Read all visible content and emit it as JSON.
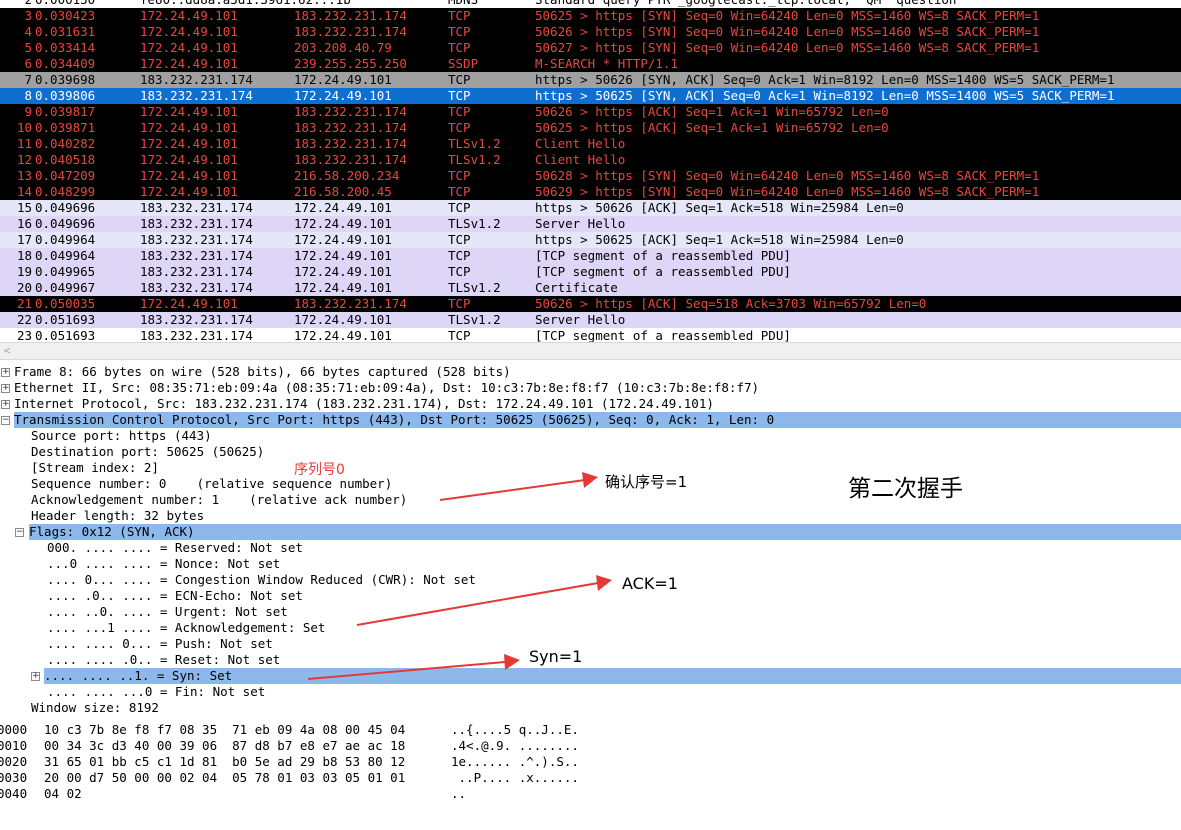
{
  "packet_list": {
    "partial_top_row": {
      "no": "2",
      "time": "0.000150",
      "src": "fe80::dd8a:a5d1:3961:62...1b",
      "dst": "",
      "proto": "MDNS",
      "info": "Standard query PTR _googlecast._tcp.local, \"QM\" question"
    },
    "rows": [
      {
        "no": "3",
        "time": "0.030423",
        "src": "172.24.49.101",
        "dst": "183.232.231.174",
        "proto": "TCP",
        "info": "50625 > https [SYN] Seq=0 Win=64240 Len=0 MSS=1460 WS=8 SACK_PERM=1",
        "style": "black"
      },
      {
        "no": "4",
        "time": "0.031631",
        "src": "172.24.49.101",
        "dst": "183.232.231.174",
        "proto": "TCP",
        "info": "50626 > https [SYN] Seq=0 Win=64240 Len=0 MSS=1460 WS=8 SACK_PERM=1",
        "style": "black"
      },
      {
        "no": "5",
        "time": "0.033414",
        "src": "172.24.49.101",
        "dst": "203.208.40.79",
        "proto": "TCP",
        "info": "50627 > https [SYN] Seq=0 Win=64240 Len=0 MSS=1460 WS=8 SACK_PERM=1",
        "style": "black"
      },
      {
        "no": "6",
        "time": "0.034409",
        "src": "172.24.49.101",
        "dst": "239.255.255.250",
        "proto": "SSDP",
        "info": "M-SEARCH * HTTP/1.1",
        "style": "black"
      },
      {
        "no": "7",
        "time": "0.039698",
        "src": "183.232.231.174",
        "dst": "172.24.49.101",
        "proto": "TCP",
        "info": "https > 50626 [SYN, ACK] Seq=0 Ack=1 Win=8192 Len=0 MSS=1400 WS=5 SACK_PERM=1",
        "style": "grey"
      },
      {
        "no": "8",
        "time": "0.039806",
        "src": "183.232.231.174",
        "dst": "172.24.49.101",
        "proto": "TCP",
        "info": "https > 50625 [SYN, ACK] Seq=0 Ack=1 Win=8192 Len=0 MSS=1400 WS=5 SACK_PERM=1",
        "style": "sel"
      },
      {
        "no": "9",
        "time": "0.039817",
        "src": "172.24.49.101",
        "dst": "183.232.231.174",
        "proto": "TCP",
        "info": "50626 > https [ACK] Seq=1 Ack=1 Win=65792 Len=0",
        "style": "black"
      },
      {
        "no": "10",
        "time": "0.039871",
        "src": "172.24.49.101",
        "dst": "183.232.231.174",
        "proto": "TCP",
        "info": "50625 > https [ACK] Seq=1 Ack=1 Win=65792 Len=0",
        "style": "black"
      },
      {
        "no": "11",
        "time": "0.040282",
        "src": "172.24.49.101",
        "dst": "183.232.231.174",
        "proto": "TLSv1.2",
        "info": "Client Hello",
        "style": "black"
      },
      {
        "no": "12",
        "time": "0.040518",
        "src": "172.24.49.101",
        "dst": "183.232.231.174",
        "proto": "TLSv1.2",
        "info": "Client Hello",
        "style": "black"
      },
      {
        "no": "13",
        "time": "0.047209",
        "src": "172.24.49.101",
        "dst": "216.58.200.234",
        "proto": "TCP",
        "info": "50628 > https [SYN] Seq=0 Win=64240 Len=0 MSS=1460 WS=8 SACK_PERM=1",
        "style": "black"
      },
      {
        "no": "14",
        "time": "0.048299",
        "src": "172.24.49.101",
        "dst": "216.58.200.45",
        "proto": "TCP",
        "info": "50629 > https [SYN] Seq=0 Win=64240 Len=0 MSS=1460 WS=8 SACK_PERM=1",
        "style": "black"
      },
      {
        "no": "15",
        "time": "0.049696",
        "src": "183.232.231.174",
        "dst": "172.24.49.101",
        "proto": "TCP",
        "info": "https > 50626 [ACK] Seq=1 Ack=518 Win=25984 Len=0",
        "style": "light"
      },
      {
        "no": "16",
        "time": "0.049696",
        "src": "183.232.231.174",
        "dst": "172.24.49.101",
        "proto": "TLSv1.2",
        "info": "Server Hello",
        "style": "lav"
      },
      {
        "no": "17",
        "time": "0.049964",
        "src": "183.232.231.174",
        "dst": "172.24.49.101",
        "proto": "TCP",
        "info": "https > 50625 [ACK] Seq=1 Ack=518 Win=25984 Len=0",
        "style": "light"
      },
      {
        "no": "18",
        "time": "0.049964",
        "src": "183.232.231.174",
        "dst": "172.24.49.101",
        "proto": "TCP",
        "info": "[TCP segment of a reassembled PDU]",
        "style": "lav"
      },
      {
        "no": "19",
        "time": "0.049965",
        "src": "183.232.231.174",
        "dst": "172.24.49.101",
        "proto": "TCP",
        "info": "[TCP segment of a reassembled PDU]",
        "style": "lav"
      },
      {
        "no": "20",
        "time": "0.049967",
        "src": "183.232.231.174",
        "dst": "172.24.49.101",
        "proto": "TLSv1.2",
        "info": "Certificate",
        "style": "lav"
      },
      {
        "no": "21",
        "time": "0.050035",
        "src": "172.24.49.101",
        "dst": "183.232.231.174",
        "proto": "TCP",
        "info": "50626 > https [ACK] Seq=518 Ack=3703 Win=65792 Len=0",
        "style": "black"
      },
      {
        "no": "22",
        "time": "0.051693",
        "src": "183.232.231.174",
        "dst": "172.24.49.101",
        "proto": "TLSv1.2",
        "info": "Server Hello",
        "style": "lav"
      },
      {
        "no": "23",
        "time": "0.051693",
        "src": "183.232.231.174",
        "dst": "172.24.49.101",
        "proto": "TCP",
        "info": "[TCP segment of a reassembled PDU]",
        "style": "white"
      }
    ]
  },
  "details": {
    "tree_top": [
      "Frame 8: 66 bytes on wire (528 bits), 66 bytes captured (528 bits)",
      "Ethernet II, Src: 08:35:71:eb:09:4a (08:35:71:eb:09:4a), Dst: 10:c3:7b:8e:f8:f7 (10:c3:7b:8e:f8:f7)",
      "Internet Protocol, Src: 183.232.231.174 (183.232.231.174), Dst: 172.24.49.101 (172.24.49.101)",
      "Transmission Control Protocol, Src Port: https (443), Dst Port: 50625 (50625), Seq: 0, Ack: 1, Len: 0"
    ],
    "tcp_fields": [
      "Source port: https (443)",
      "Destination port: 50625 (50625)",
      "[Stream index: 2]",
      "Sequence number: 0    (relative sequence number)",
      "Acknowledgement number: 1    (relative ack number)",
      "Header length: 32 bytes"
    ],
    "flags_header": "Flags: 0x12 (SYN, ACK)",
    "flags": [
      "000. .... .... = Reserved: Not set",
      "...0 .... .... = Nonce: Not set",
      ".... 0... .... = Congestion Window Reduced (CWR): Not set",
      ".... .0.. .... = ECN-Echo: Not set",
      ".... ..0. .... = Urgent: Not set",
      ".... ...1 .... = Acknowledgement: Set",
      ".... .... 0... = Push: Not set",
      ".... .... .0.. = Reset: Not set",
      ".... .... ..1. = Syn: Set",
      ".... .... ...0 = Fin: Not set"
    ],
    "window_size": "Window size: 8192"
  },
  "hex": [
    {
      "off": "0000",
      "bytes": "10 c3 7b 8e f8 f7 08 35  71 eb 09 4a 08 00 45 04",
      "ascii": "..{....5 q..J..E."
    },
    {
      "off": "0010",
      "bytes": "00 34 3c d3 40 00 39 06  87 d8 b7 e8 e7 ae ac 18",
      "ascii": ".4<.@.9. ........"
    },
    {
      "off": "0020",
      "bytes": "31 65 01 bb c5 c1 1d 81  b0 5e ad 29 b8 53 80 12",
      "ascii": "1e...... .^.).S.."
    },
    {
      "off": "0030",
      "bytes": "20 00 d7 50 00 00 02 04  05 78 01 03 03 05 01 01",
      "ascii": " ..P.... .x......"
    },
    {
      "off": "0040",
      "bytes": "04 02",
      "ascii": ".."
    }
  ],
  "annotations": {
    "seq_label": "序列号0",
    "ack_num_label": "确认序号=1",
    "handshake_label": "第二次握手",
    "ack_flag_label": "ACK=1",
    "syn_flag_label": "Syn=1"
  },
  "colors": {
    "annotation_red": "#e53935",
    "selected_row": "#0e6fd0",
    "detail_highlight": "#8cb8ec",
    "bad_tcp_text": "#e8463e"
  }
}
